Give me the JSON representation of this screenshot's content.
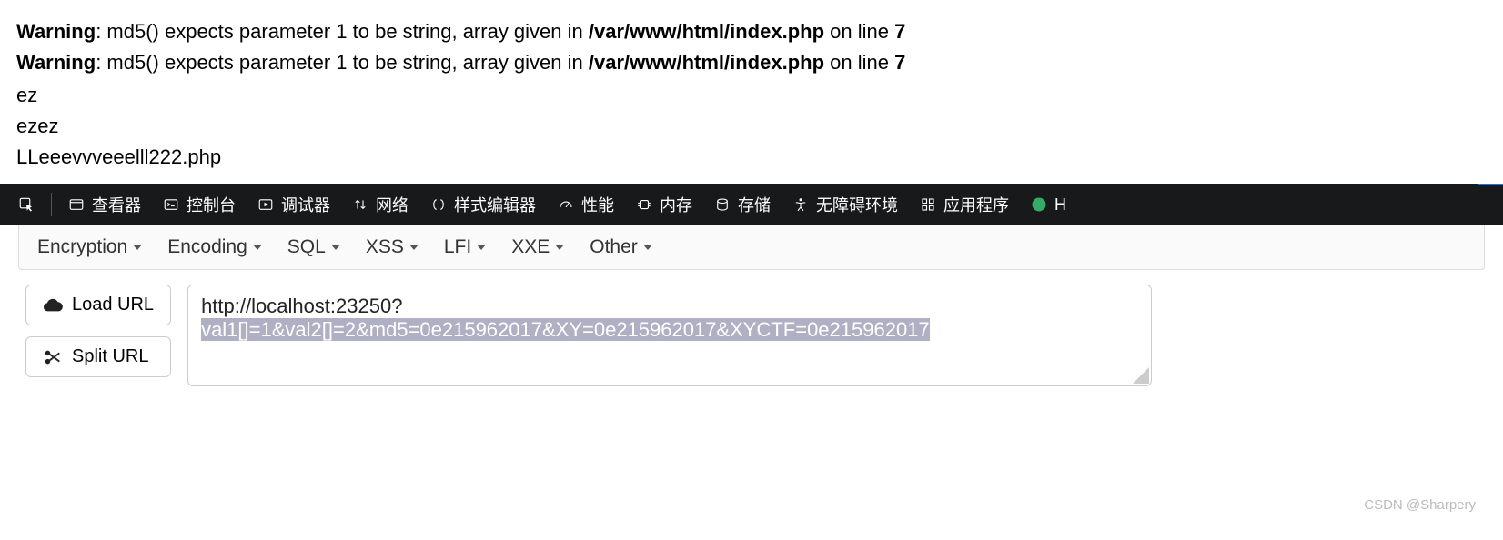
{
  "output": {
    "warnings": [
      {
        "prefix": "Warning",
        "msg": ": md5() expects parameter 1 to be string, array given in ",
        "file": "/var/www/html/index.php",
        "on_line": " on line ",
        "line_no": "7"
      },
      {
        "prefix": "Warning",
        "msg": ": md5() expects parameter 1 to be string, array given in ",
        "file": "/var/www/html/index.php",
        "on_line": " on line ",
        "line_no": "7"
      }
    ],
    "lines": [
      "ez",
      "ezez",
      "LLeeevvveeelll222.php"
    ]
  },
  "devtools": {
    "tabs": [
      "查看器",
      "控制台",
      "调试器",
      "网络",
      "样式编辑器",
      "性能",
      "内存",
      "存储",
      "无障碍环境",
      "应用程序"
    ],
    "extra": "H"
  },
  "tools": {
    "items": [
      "Encryption",
      "Encoding",
      "SQL",
      "XSS",
      "LFI",
      "XXE",
      "Other"
    ]
  },
  "actions": {
    "load": "Load URL",
    "split": "Split URL"
  },
  "url": {
    "line1": "http://localhost:23250?",
    "line2": "val1[]=1&val2[]=2&md5=0e215962017&XY=0e215962017&XYCTF=0e215962017"
  },
  "watermark": "CSDN @Sharpery"
}
